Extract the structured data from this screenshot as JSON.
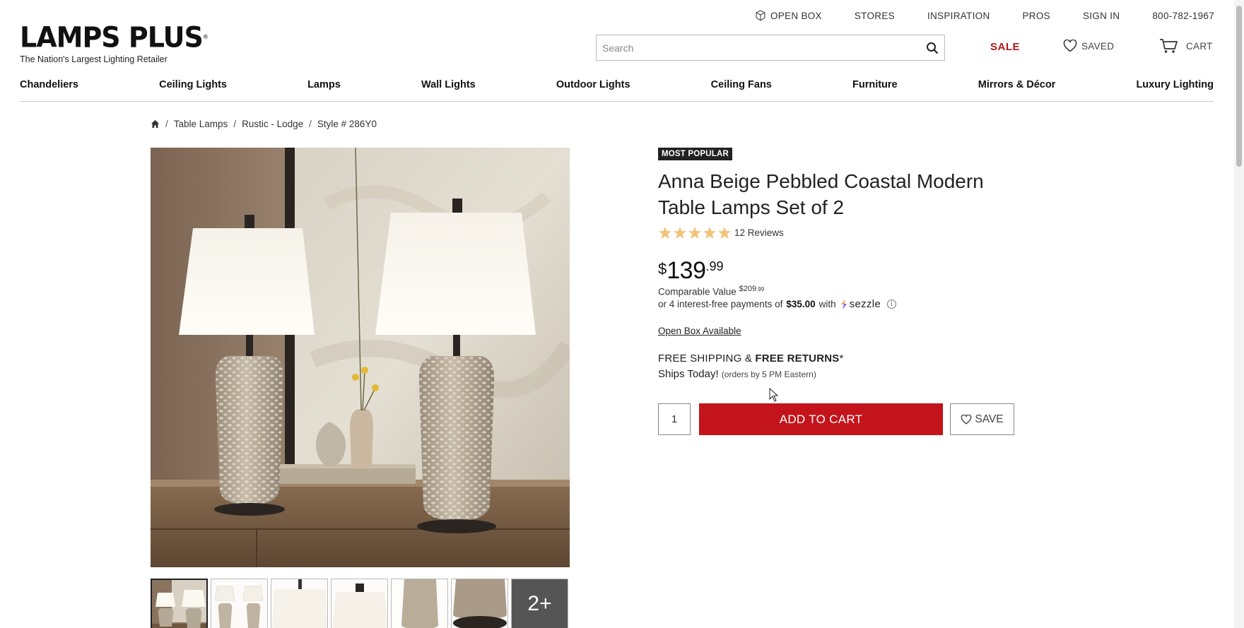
{
  "util_nav": {
    "open_box": "OPEN BOX",
    "stores": "STORES",
    "inspiration": "INSPIRATION",
    "pros": "PROS",
    "sign_in": "SIGN IN",
    "phone": "800-782-1967"
  },
  "logo": {
    "name": "LAMPS PLUS",
    "tagline": "The Nation's Largest Lighting Retailer"
  },
  "search": {
    "placeholder": "Search",
    "value": ""
  },
  "header": {
    "sale": "SALE",
    "saved": "SAVED",
    "cart": "CART"
  },
  "nav": {
    "items": [
      "Chandeliers",
      "Ceiling Lights",
      "Lamps",
      "Wall Lights",
      "Outdoor Lights",
      "Ceiling Fans",
      "Furniture",
      "Mirrors & Décor",
      "Luxury Lighting"
    ]
  },
  "breadcrumb": {
    "items": [
      "Table Lamps",
      "Rustic - Lodge",
      "Style # 286Y0"
    ]
  },
  "gallery": {
    "more_label": "2+"
  },
  "product": {
    "badge": "MOST POPULAR",
    "title": "Anna Beige Pebbled Coastal Modern Table Lamps Set of 2",
    "rating": 5,
    "reviews": "12 Reviews",
    "price_currency": "$",
    "price_dollars": "139",
    "price_cents": ".99",
    "comparable_label": "Comparable Value",
    "comparable_value": "$209",
    "comparable_cents": ".99",
    "installment_prefix": "or 4 interest-free payments of",
    "installment_amount": "$35.00",
    "installment_with": "with",
    "sezzle": "sezzle",
    "open_box": "Open Box Available",
    "shipping_free": "FREE SHIPPING &",
    "free_returns": "FREE RETURNS",
    "asterisk": "*",
    "ships_today": "Ships Today!",
    "ships_note": "(orders by 5 PM Eastern)",
    "quantity": "1",
    "add_to_cart": "ADD TO CART",
    "save": "SAVE"
  },
  "colors": {
    "accent_red": "#c4141b",
    "sale_red": "#b3161e",
    "star": "#f2c47a"
  }
}
